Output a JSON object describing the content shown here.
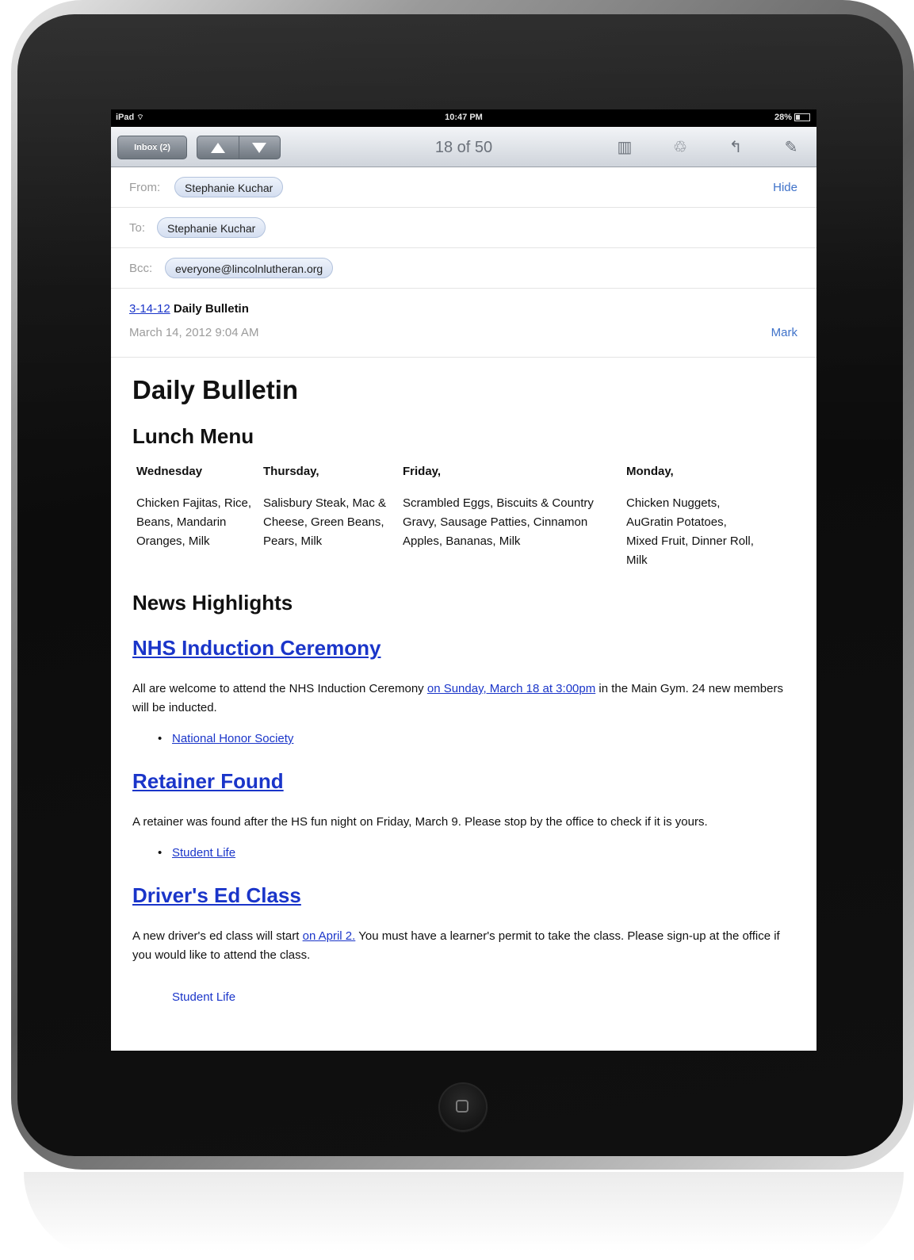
{
  "status_bar": {
    "carrier": "iPad",
    "time": "10:47 PM",
    "battery": "28%"
  },
  "toolbar": {
    "inbox_label": "Inbox (2)",
    "counter": "18 of 50"
  },
  "header": {
    "from_label": "From:",
    "from_name": "Stephanie Kuchar",
    "hide_label": "Hide",
    "to_label": "To:",
    "to_name": "Stephanie Kuchar",
    "bcc_label": "Bcc:",
    "bcc_address": "everyone@lincolnlutheran.org",
    "subject_date_link": "3-14-12",
    "subject_rest": " Daily Bulletin",
    "date": "March 14, 2012 9:04 AM",
    "mark_label": "Mark"
  },
  "bulletin": {
    "title": "Daily Bulletin",
    "lunch_heading": "Lunch Menu",
    "lunch_days": [
      "Wednesday",
      "Thursday,",
      "Friday,",
      "Monday,"
    ],
    "lunch_items": [
      "Chicken Fajitas, Rice, Beans, Mandarin Oranges, Milk",
      "Salisbury Steak, Mac & Cheese, Green Beans, Pears, Milk",
      "Scrambled Eggs, Biscuits & Country Gravy, Sausage Patties, Cinnamon Apples, Bananas, Milk",
      "Chicken Nuggets, AuGratin Potatoes, Mixed Fruit, Dinner Roll, Milk"
    ],
    "news_heading": "News Highlights",
    "items": [
      {
        "title": "NHS Induction Ceremony",
        "text_before": "All are welcome to attend the NHS Induction Ceremony ",
        "link": "on Sunday, March 18 at 3:00pm",
        "text_after": " in the Main Gym.  24 new members will be inducted.",
        "bullet": "National Honor Society"
      },
      {
        "title": "Retainer Found",
        "text": "A retainer was found after the HS fun night on Friday, March 9.  Please stop by the office to check if it is yours.",
        "bullet": "Student Life"
      },
      {
        "title": "Driver's Ed Class",
        "text_before": "A new driver's ed class will start ",
        "link": "on April 2.",
        "text_after": "  You must have a learner's permit to take the class. Please sign-up at the office if you would like to attend the class.",
        "bullet": "Student Life"
      }
    ]
  }
}
